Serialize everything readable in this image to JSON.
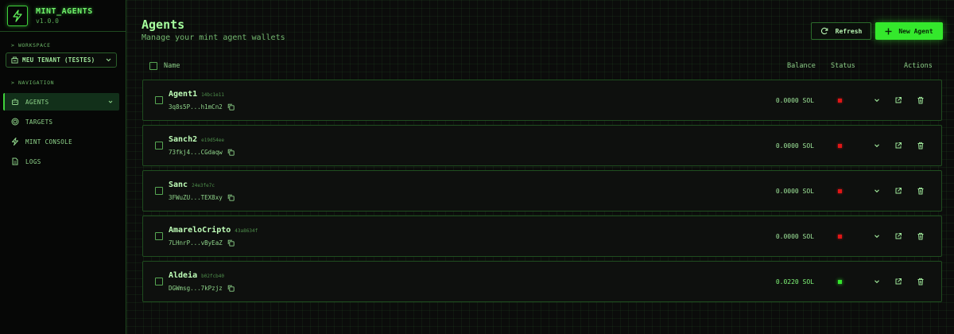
{
  "brand": {
    "title": "MINT_AGENTS",
    "version": "v1.0.0"
  },
  "sidebar": {
    "workspace_label": "> WORKSPACE",
    "tenant": "MEU TENANT (TESTES)",
    "navigation_label": "> NAVIGATION",
    "items": [
      {
        "label": "AGENTS",
        "icon": "bot-icon",
        "active": true
      },
      {
        "label": "TARGETS",
        "icon": "target-icon",
        "active": false
      },
      {
        "label": "MINT CONSOLE",
        "icon": "bolt-icon",
        "active": false
      },
      {
        "label": "LOGS",
        "icon": "document-icon",
        "active": false
      }
    ]
  },
  "header": {
    "title": "Agents",
    "subtitle": "Manage your mint agent wallets",
    "refresh_label": "Refresh",
    "new_agent_label": "New Agent"
  },
  "columns": {
    "name": "Name",
    "balance": "Balance",
    "status": "Status",
    "actions": "Actions"
  },
  "agents": [
    {
      "name": "Agent1",
      "id": "14bc1e11",
      "address": "3q8s5P...h1mCn2",
      "balance": "0.0000 SOL",
      "status": "inactive"
    },
    {
      "name": "Sanch2",
      "id": "e19d54ee",
      "address": "73fkj4...CGdaqw",
      "balance": "0.0000 SOL",
      "status": "inactive"
    },
    {
      "name": "Sanc",
      "id": "24e3fe7c",
      "address": "3FWuZU...TEX8xy",
      "balance": "0.0000 SOL",
      "status": "inactive"
    },
    {
      "name": "AmareloCripto",
      "id": "43a8634f",
      "address": "7LHnrP...vByEaZ",
      "balance": "0.0000 SOL",
      "status": "inactive"
    },
    {
      "name": "Aldeia",
      "id": "b02fcb40",
      "address": "DGWmsg...7kPzjz",
      "balance": "0.0220 SOL",
      "status": "active"
    }
  ],
  "colors": {
    "accent": "#34e82c",
    "status_active": "#35e52d",
    "status_inactive": "#e01616",
    "background": "#0b0c0b"
  }
}
